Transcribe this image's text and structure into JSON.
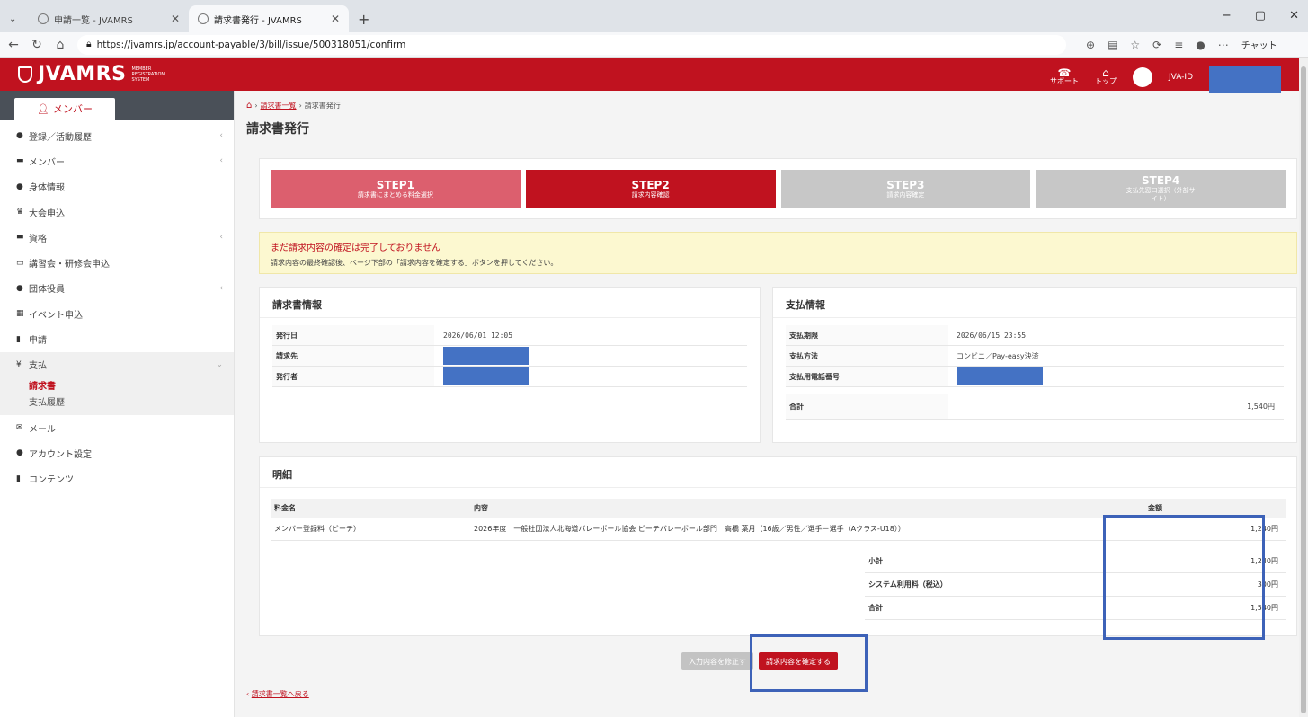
{
  "browser": {
    "tabs": [
      {
        "title": "申請一覧 - JVAMRS",
        "active": false
      },
      {
        "title": "請求書発行 - JVAMRS",
        "active": true
      }
    ],
    "new_tab": "+",
    "url": "https://jvamrs.jp/account-payable/3/bill/issue/500318051/confirm",
    "chat_label": "チャット",
    "window_controls": [
      "−",
      "▢",
      "✕"
    ]
  },
  "header": {
    "logo_text": "JVAMRS",
    "logo_sub": "MEMBER REGISTRATION SYSTEM",
    "support_label": "サポート",
    "top_label": "トップ",
    "user_id_prefix": "JVA-ID"
  },
  "sidebar": {
    "tab_label": "メンバー",
    "items": [
      {
        "icon": "person-icon",
        "label": "登録／活動履歴",
        "chevron": true
      },
      {
        "icon": "card-icon",
        "label": "メンバー",
        "chevron": true
      },
      {
        "icon": "person-plus-icon",
        "label": "身体情報",
        "chevron": false
      },
      {
        "icon": "trophy-icon",
        "label": "大会申込",
        "chevron": false
      },
      {
        "icon": "card-icon",
        "label": "資格",
        "chevron": true
      },
      {
        "icon": "board-icon",
        "label": "講習会・研修会申込",
        "chevron": false
      },
      {
        "icon": "person-icon",
        "label": "団体役員",
        "chevron": true
      },
      {
        "icon": "calendar-icon",
        "label": "イベント申込",
        "chevron": false
      },
      {
        "icon": "doc-icon",
        "label": "申請",
        "chevron": false
      }
    ],
    "payment": {
      "icon": "yen-icon",
      "label": "支払",
      "subitems": [
        "請求書",
        "支払履歴"
      ],
      "active_sub": "請求書"
    },
    "bottom_items": [
      {
        "icon": "mail-icon",
        "label": "メール"
      },
      {
        "icon": "people-icon",
        "label": "アカウント設定"
      },
      {
        "icon": "doc-icon",
        "label": "コンテンツ"
      }
    ]
  },
  "breadcrumb": {
    "home": "⌂",
    "link": "請求書一覧",
    "current": "請求書発行"
  },
  "page_title": "請求書発行",
  "steps": [
    {
      "title": "STEP1",
      "sub": "請求書にまとめる料金選択"
    },
    {
      "title": "STEP2",
      "sub": "請求内容確認"
    },
    {
      "title": "STEP3",
      "sub": "請求内容確定"
    },
    {
      "title": "STEP4",
      "sub": "支払先窓口選択（外部サイト）"
    }
  ],
  "notice": {
    "heading": "まだ請求内容の確定は完了しておりません",
    "body": "請求内容の最終確認後、ページ下部の「請求内容を確定する」ボタンを押してください。"
  },
  "invoice": {
    "title": "請求書情報",
    "issue_date_label": "発行日",
    "issue_date": "2026/06/01 12:05",
    "billto_label": "請求先",
    "issuer_label": "発行者"
  },
  "payment_info": {
    "title": "支払情報",
    "due_label": "支払期限",
    "due": "2026/06/15 23:55",
    "method_label": "支払方法",
    "method": "コンビニ／Pay-easy決済",
    "phone_label": "支払用電話番号",
    "total_label": "合計",
    "total": "1,540円"
  },
  "details": {
    "title": "明細",
    "headers": {
      "fee": "料金名",
      "content": "内容",
      "amount": "金額"
    },
    "rows": [
      {
        "fee": "メンバー登録料（ビーチ）",
        "content": "2026年度　一般社団法人北海道バレーボール協会 ビーチバレーボール部門　高橋 葉月（16歳／男性／選手－選手（Aクラス-U18））",
        "amount": "1,240円"
      }
    ],
    "subtotal_label": "小計",
    "subtotal": "1,240円",
    "system_fee_label": "システム利用料（税込）",
    "system_fee": "300円",
    "total_label": "合計",
    "total": "1,540円"
  },
  "buttons": {
    "edit": "入力内容を修正す",
    "confirm": "請求内容を確定する"
  },
  "back_link": "請求書一覧へ戻る",
  "colors": {
    "brand_red": "#c0121f",
    "step1": "#dc5f6e",
    "step_inactive": "#c7c7c7",
    "highlight": "#3d62b8",
    "redaction": "#4472c4"
  }
}
